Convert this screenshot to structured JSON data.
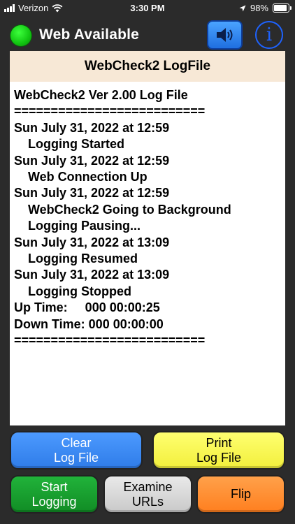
{
  "status_bar": {
    "carrier": "Verizon",
    "time": "3:30 PM",
    "battery_percent": "98%",
    "battery_level": 0.98
  },
  "header": {
    "connection_status": "Web Available",
    "status_color": "#11c511",
    "sound_icon": "speaker-icon",
    "info_icon": "info-icon",
    "info_glyph": "i"
  },
  "log": {
    "title": "WebCheck2 LogFile",
    "lines": [
      {
        "text": "WebCheck2 Ver 2.00 Log File",
        "indent": false
      },
      {
        "text": "==========================",
        "indent": false
      },
      {
        "text": "Sun July 31, 2022 at 12:59",
        "indent": false
      },
      {
        "text": "Logging Started",
        "indent": true
      },
      {
        "text": "Sun July 31, 2022 at 12:59",
        "indent": false
      },
      {
        "text": "Web Connection Up",
        "indent": true
      },
      {
        "text": "Sun July 31, 2022 at 12:59",
        "indent": false
      },
      {
        "text": "WebCheck2 Going to Background",
        "indent": true
      },
      {
        "text": "Logging Pausing...",
        "indent": true
      },
      {
        "text": "Sun July 31, 2022 at 13:09",
        "indent": false
      },
      {
        "text": "Logging Resumed",
        "indent": true
      },
      {
        "text": "Sun July 31, 2022 at 13:09",
        "indent": false
      },
      {
        "text": "Logging Stopped",
        "indent": true
      },
      {
        "text": "Up Time:     000 00:00:25",
        "indent": false
      },
      {
        "text": "Down Time: 000 00:00:00",
        "indent": false
      },
      {
        "text": "==========================",
        "indent": false
      }
    ]
  },
  "buttons": {
    "clear": "Clear\nLog File",
    "print": "Print\nLog File",
    "start": "Start\nLogging",
    "examine": "Examine\nURLs",
    "flip": "Flip"
  }
}
